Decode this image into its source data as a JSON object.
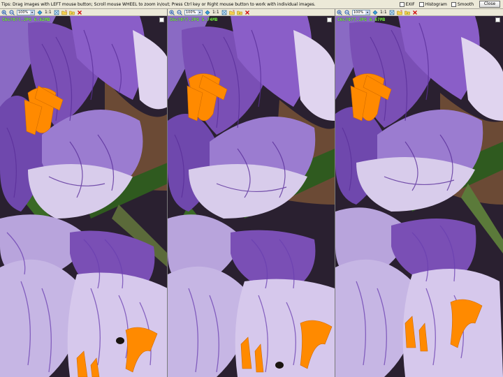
{
  "tips": "Tips: Drag images with LEFT mouse button; Scroll mouse WHEEL to zoom in/out; Press Ctrl key or Right mouse button to work with individual images.",
  "options": [
    {
      "label": "EXIF",
      "checked": false
    },
    {
      "label": "Histogram",
      "checked": false
    },
    {
      "label": "Smooth",
      "checked": false
    }
  ],
  "close_label": "Close",
  "panes": [
    {
      "zoom": "100%",
      "ratio": "1:1",
      "caption": "C6c?0??.JPG   6.62MB"
    },
    {
      "zoom": "100%",
      "ratio": "1:1",
      "caption": "C6c?0??.JPG   5.74MB"
    },
    {
      "zoom": "100%",
      "ratio": "1:1",
      "caption": "C6c?0??.JPG   6.67MB"
    }
  ],
  "icons": [
    "zoom-in-icon",
    "zoom-out-icon",
    "zoom-select",
    "fit-icon",
    "actual-size",
    "fullscreen-icon",
    "open-folder-icon",
    "rotate-icon",
    "close-image-icon"
  ],
  "colors": {
    "petal_purple": "#7a4fb5",
    "petal_white": "#e4dcf0",
    "stamen_orange": "#ff8a00",
    "leaf_green": "#2f5a1f",
    "soil": "#5a4030",
    "caption_green": "#7cff4a"
  }
}
